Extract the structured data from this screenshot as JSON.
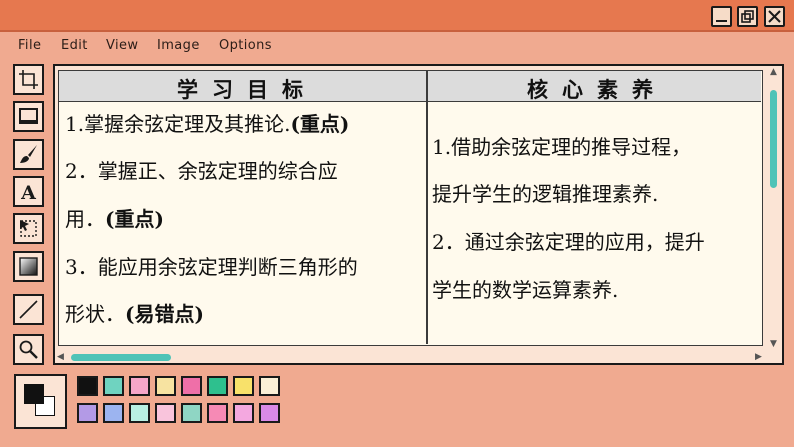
{
  "menu": {
    "file": "File",
    "edit": "Edit",
    "view": "View",
    "image": "Image",
    "options": "Options"
  },
  "icons": {
    "tools": [
      "crop-icon",
      "rectangle-select-icon",
      "brush-icon",
      "text-icon",
      "free-select-icon",
      "gradient-icon",
      "line-icon",
      "magnifier-icon"
    ],
    "window": [
      "minimize-icon",
      "restore-icon",
      "close-icon"
    ]
  },
  "document": {
    "left_header": "学习目标",
    "right_header": "核心素养",
    "left": {
      "l1_text": "1.掌握余弦定理及其推论.",
      "l1_tag": "(重点)",
      "l2_text": "2．掌握正、余弦定理的综合应",
      "l3_text": "用．",
      "l3_tag": "(重点)",
      "l4_text": "3．能应用余弦定理判断三角形的",
      "l5_text": "形状．",
      "l5_tag": "(易错点)"
    },
    "right": {
      "r1": "1.借助余弦定理的推导过程，",
      "r2": "提升学生的逻辑推理素养.",
      "r3": "2．通过余弦定理的应用，提升",
      "r4": "学生的数学运算素养."
    }
  },
  "palette": {
    "foreground": "#111111",
    "background": "#ffffff",
    "row1": [
      "#111111",
      "#6fd3c0",
      "#f6a6c8",
      "#f7e3a1",
      "#ef6fa8",
      "#2ec08e",
      "#f8e16a",
      "#fbf0d6"
    ],
    "row2": [
      "#b39ae6",
      "#9cb4f0",
      "#b9f0e3",
      "#f9c4dc",
      "#8fd6c4",
      "#f68ab5",
      "#f4a8e0",
      "#d98ae6"
    ]
  }
}
